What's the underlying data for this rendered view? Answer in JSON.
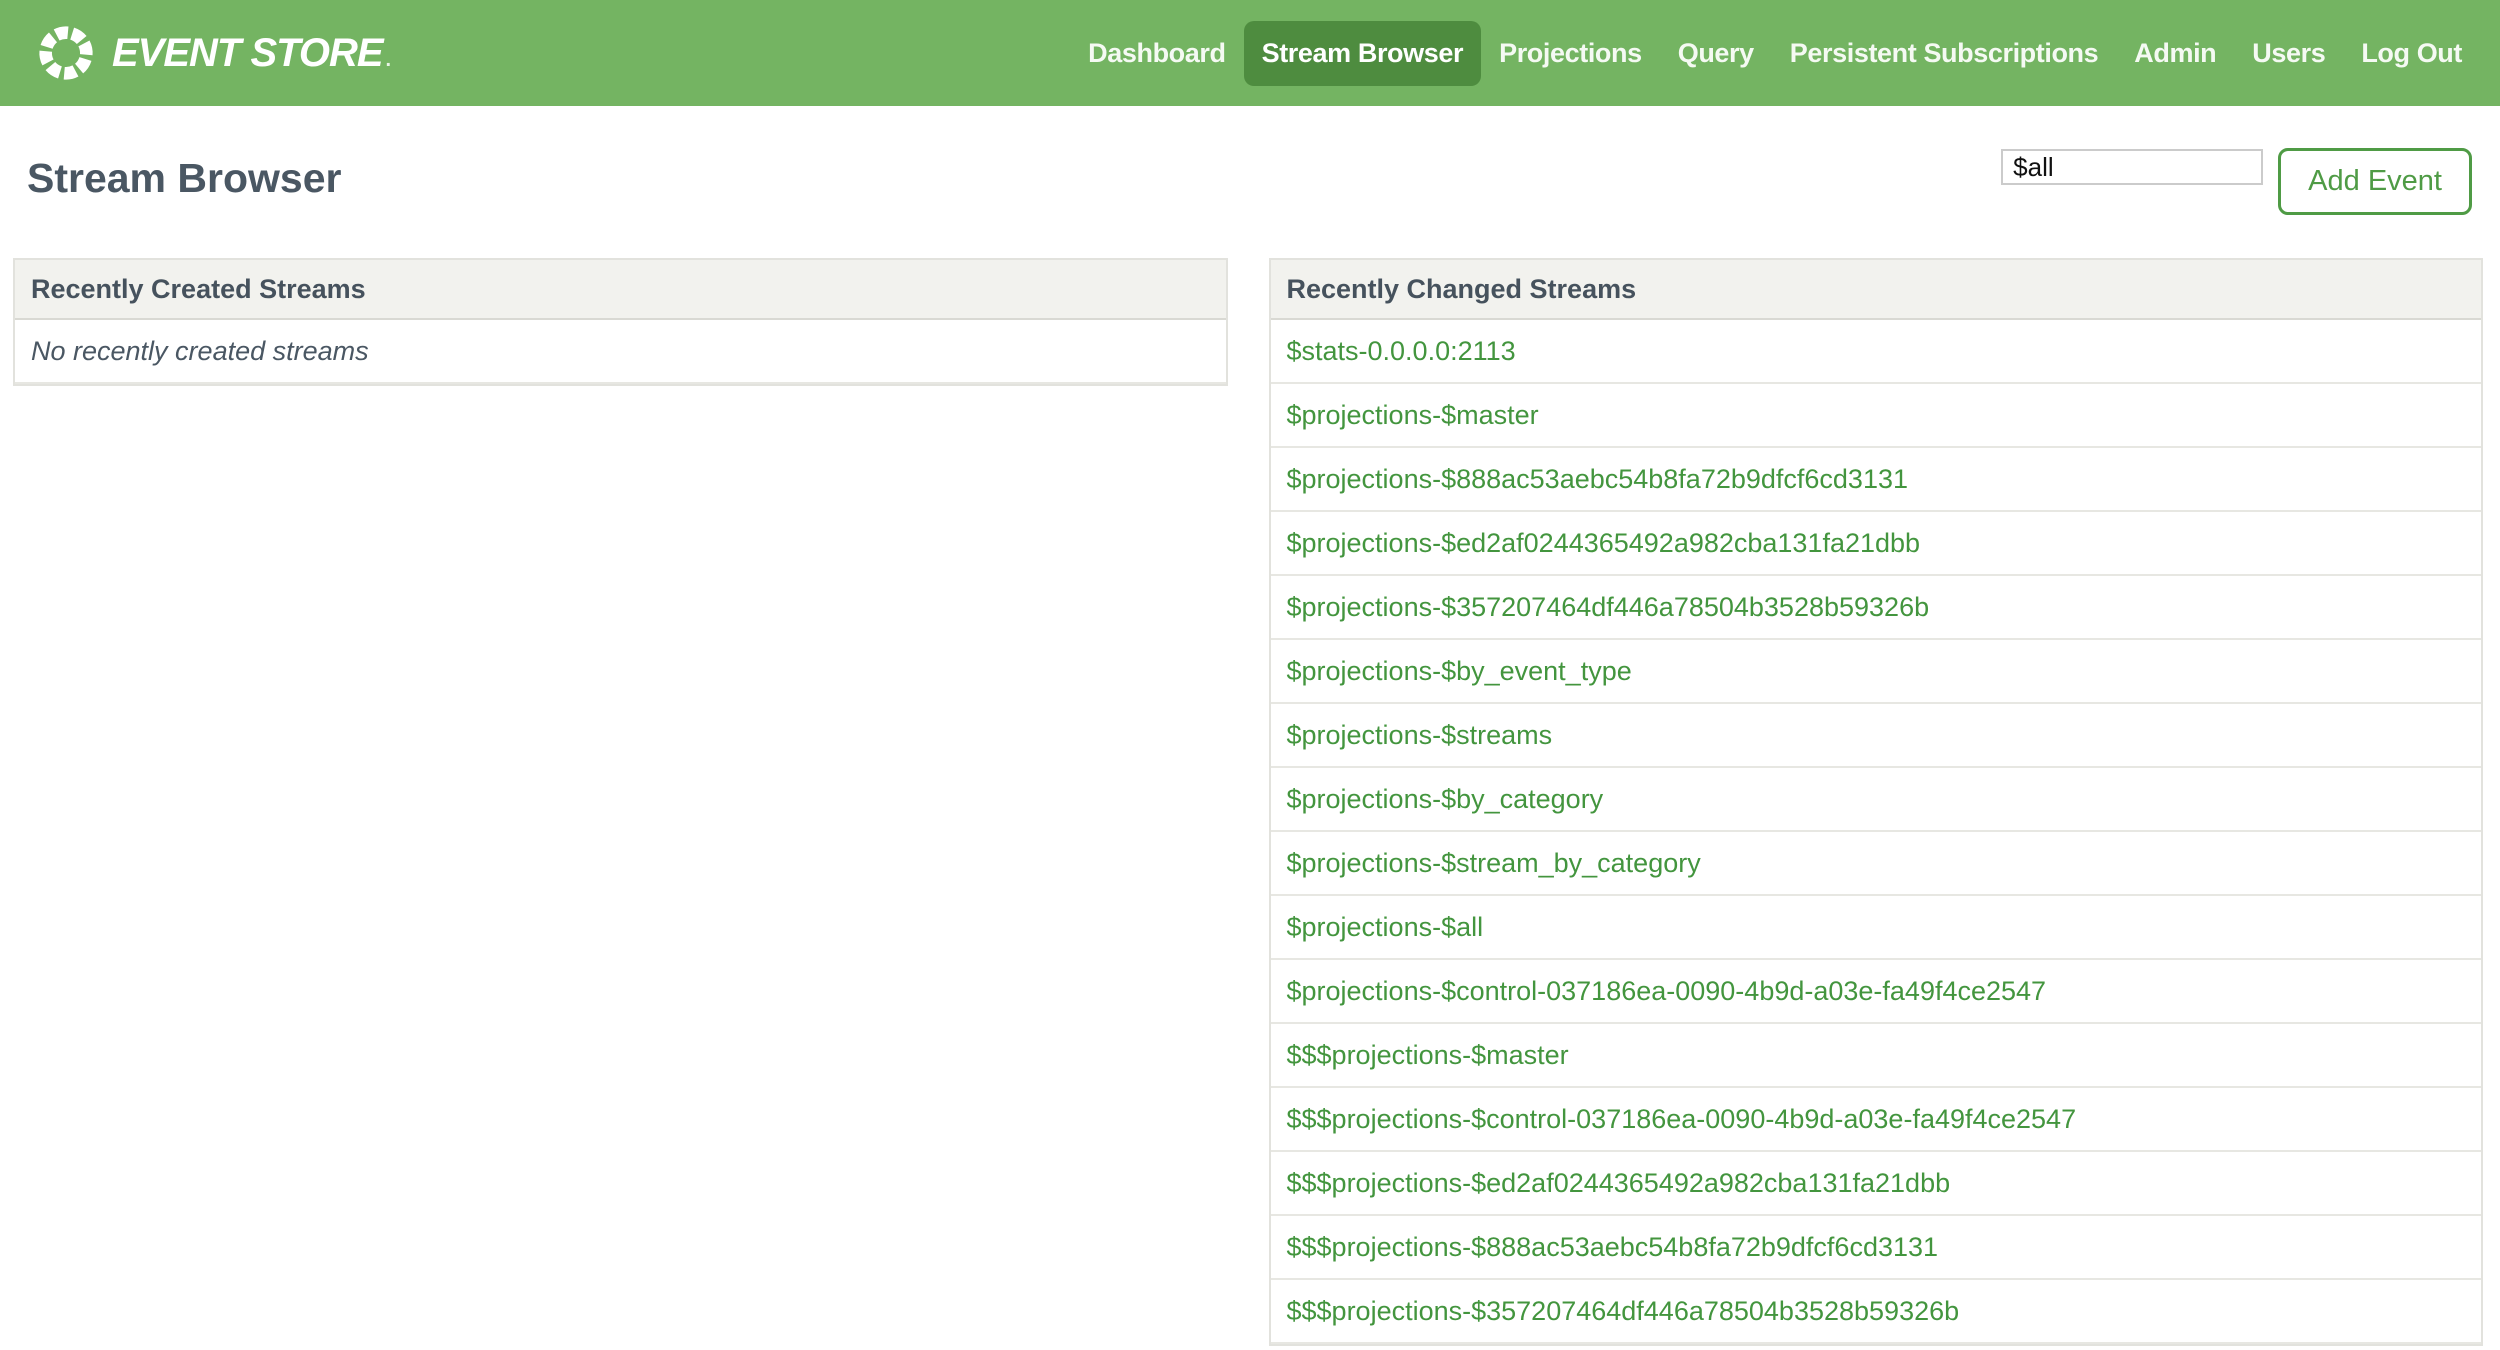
{
  "navbar": {
    "brand": {
      "name": "EVENT STORE",
      "mark": "."
    },
    "items": [
      {
        "label": "Dashboard",
        "active": false
      },
      {
        "label": "Stream Browser",
        "active": true
      },
      {
        "label": "Projections",
        "active": false
      },
      {
        "label": "Query",
        "active": false
      },
      {
        "label": "Persistent Subscriptions",
        "active": false
      },
      {
        "label": "Admin",
        "active": false
      },
      {
        "label": "Users",
        "active": false
      },
      {
        "label": "Log Out",
        "active": false
      }
    ]
  },
  "header": {
    "title": "Stream Browser",
    "stream_input_value": "$all",
    "add_event_label": "Add Event"
  },
  "panels": {
    "created": {
      "title": "Recently Created Streams",
      "empty_message": "No recently created streams"
    },
    "changed": {
      "title": "Recently Changed Streams",
      "streams": [
        "$stats-0.0.0.0:2113",
        "$projections-$master",
        "$projections-$888ac53aebc54b8fa72b9dfcf6cd3131",
        "$projections-$ed2af0244365492a982cba131fa21dbb",
        "$projections-$357207464df446a78504b3528b59326b",
        "$projections-$by_event_type",
        "$projections-$streams",
        "$projections-$by_category",
        "$projections-$stream_by_category",
        "$projections-$all",
        "$projections-$control-037186ea-0090-4b9d-a03e-fa49f4ce2547",
        "$$$projections-$master",
        "$$$projections-$control-037186ea-0090-4b9d-a03e-fa49f4ce2547",
        "$$$projections-$ed2af0244365492a982cba131fa21dbb",
        "$$$projections-$888ac53aebc54b8fa72b9dfcf6cd3131",
        "$$$projections-$357207464df446a78504b3528b59326b"
      ]
    }
  },
  "colors": {
    "navbar_bg": "#74b462",
    "navbar_active_bg": "#4e8c3f",
    "link_green": "#43953e",
    "button_green": "#4f9b45",
    "heading_text": "#4a5763",
    "panel_header_bg": "#f2f2ee",
    "panel_border": "#e2e2dd"
  }
}
